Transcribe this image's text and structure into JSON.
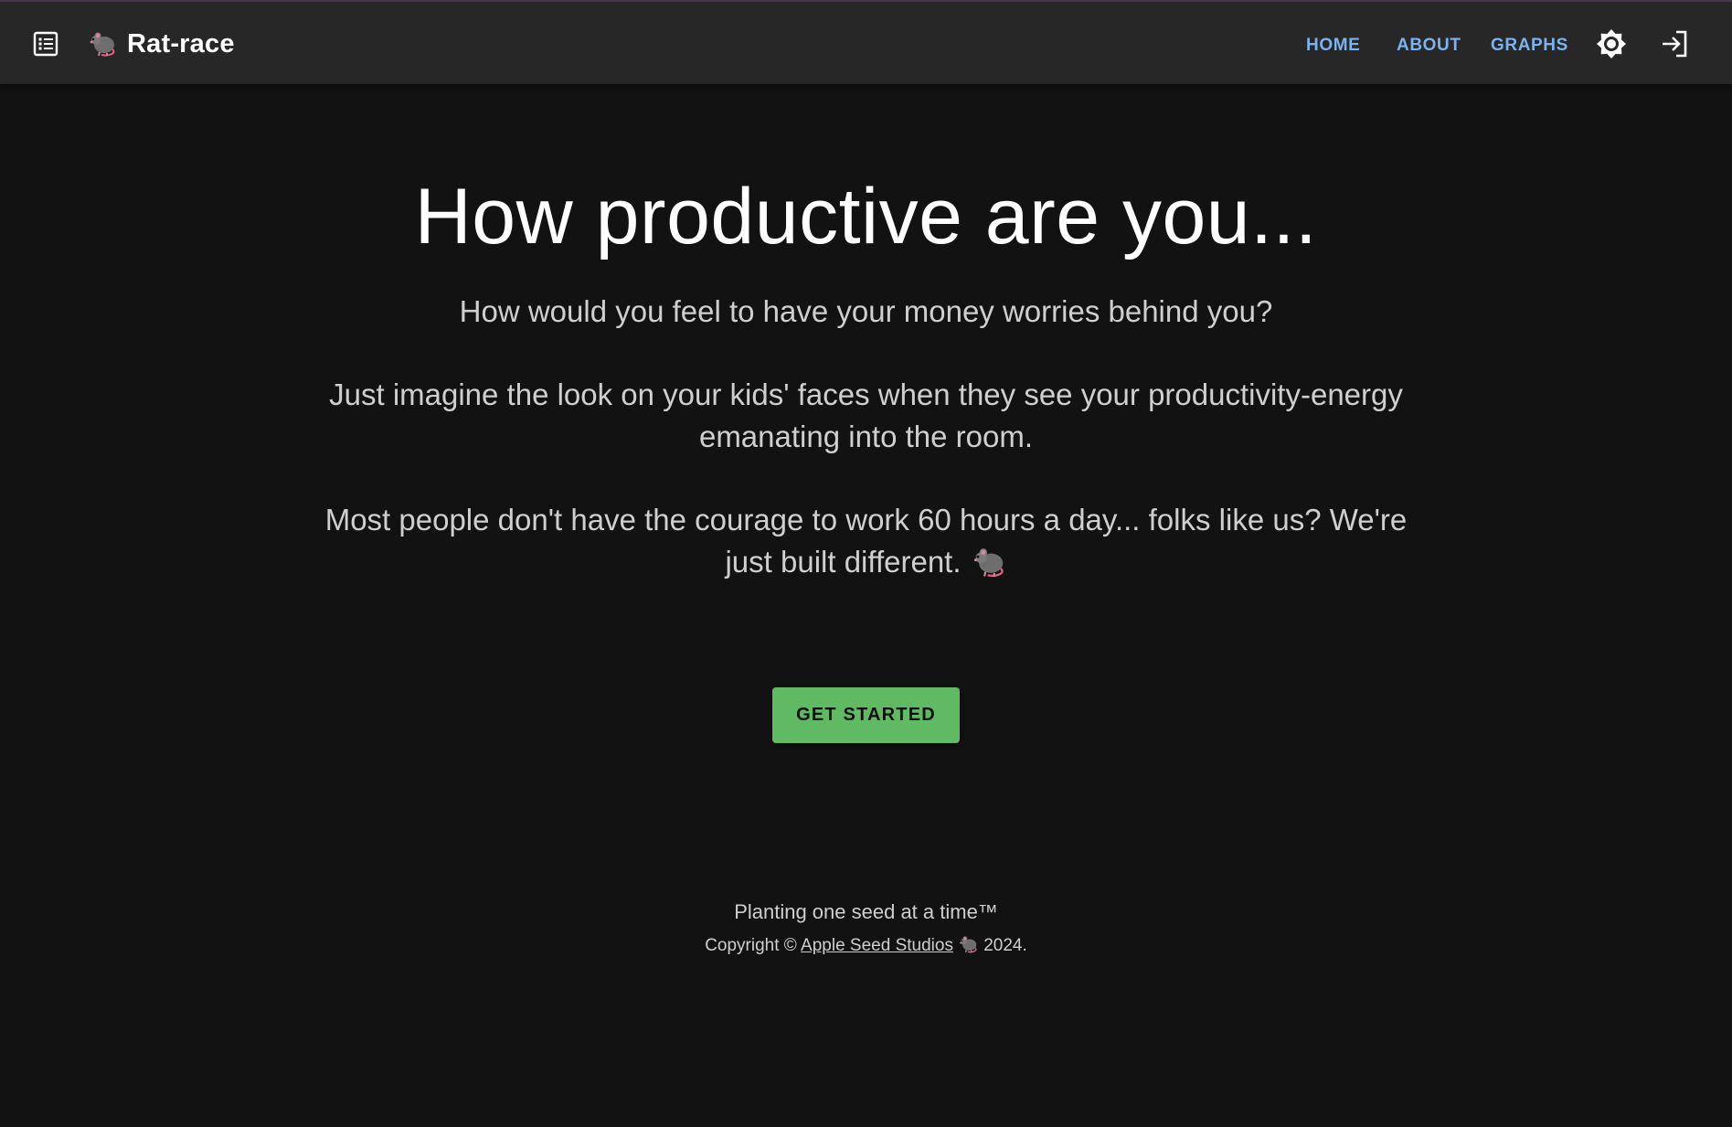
{
  "app": {
    "title": "Rat-race",
    "logo_icon": "rat-icon"
  },
  "nav": {
    "items": [
      {
        "label": "HOME"
      },
      {
        "label": "ABOUT"
      },
      {
        "label": "GRAPHS"
      }
    ],
    "theme_icon": "brightness-icon",
    "login_icon": "login-icon",
    "menu_icon": "list-icon"
  },
  "hero": {
    "title": "How productive are you...",
    "paragraphs": [
      "How would you feel to have your money worries behind you?",
      "Just imagine the look on your kids' faces when they see your productivity-energy emanating into the room.",
      "Most people don't have the courage to work 60 hours a day... folks like us? We're just built different."
    ],
    "cta_label": "GET STARTED"
  },
  "footer": {
    "tagline": "Planting one seed at a time™",
    "copyright_prefix": "Copyright ©",
    "studio_name": "Apple Seed Studios",
    "copyright_suffix": "2024."
  },
  "colors": {
    "background": "#121212",
    "appbar": "#272727",
    "nav_link": "#7cb2ee",
    "cta": "#5fba63"
  }
}
